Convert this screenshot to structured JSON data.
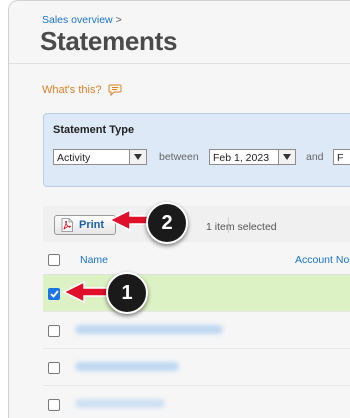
{
  "header": {
    "breadcrumb": "Sales overview",
    "breadcrumb_sep": ">",
    "title": "Statements"
  },
  "help": {
    "label": "What's this?"
  },
  "filter": {
    "title": "Statement Type",
    "type_value": "Activity",
    "between_label": "between",
    "from_date": "Feb 1, 2023",
    "and_label": "and",
    "to_date_partial": "F"
  },
  "toolbar": {
    "print_label": "Print",
    "selected_text": "1 item selected"
  },
  "table": {
    "columns": [
      "Name",
      "Account No."
    ],
    "rows": [
      {
        "checked": true,
        "name_redacted": true
      },
      {
        "checked": false,
        "name_redacted": true
      },
      {
        "checked": false,
        "name_redacted": true
      },
      {
        "checked": false,
        "name_redacted": true
      }
    ]
  },
  "callouts": [
    {
      "number": "1",
      "target": "row-checkbox"
    },
    {
      "number": "2",
      "target": "print-button"
    }
  ],
  "colors": {
    "link": "#1a73c8",
    "help": "#d9822b",
    "selected_row": "#ddf2c4",
    "filter_panel": "#dde9f7",
    "callout_arrow": "#e0102a",
    "checkbox_checked": "#1b74e4"
  }
}
